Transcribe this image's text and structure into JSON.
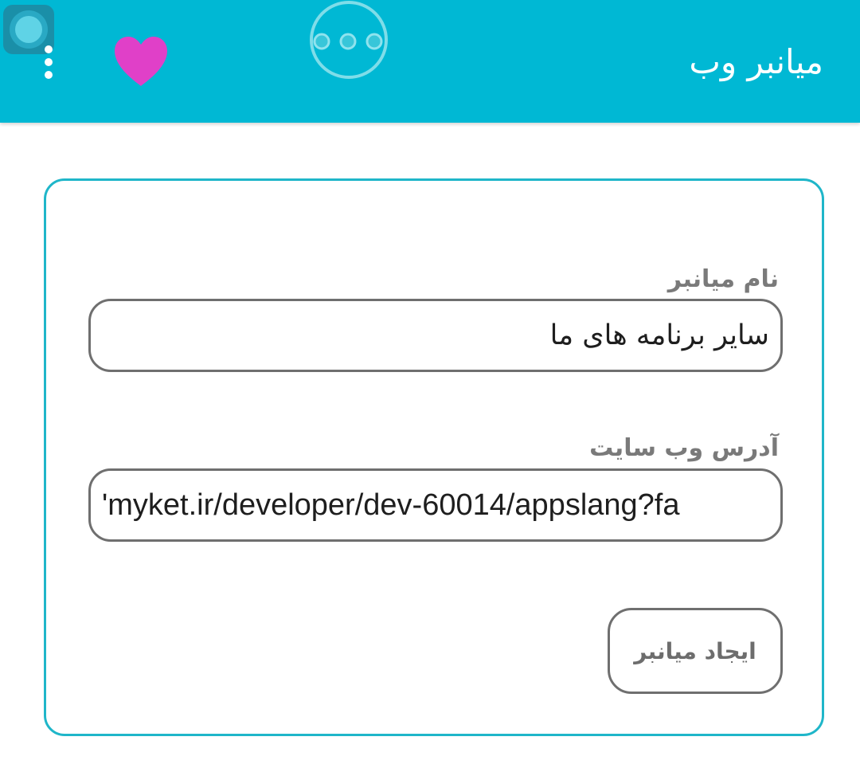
{
  "appbar": {
    "title": "میانبر وب",
    "color": "#00b8d4",
    "icons": {
      "menu": "overflow-menu-icon",
      "favorite": "heart-icon",
      "more": "more-horizontal-icon",
      "assistant": "assistant-bubble-icon"
    },
    "heart_color": "#e040c8"
  },
  "form": {
    "name_label": "نام میانبر",
    "name_value": "سایر برنامه های ما",
    "url_label": "آدرس وب سایت",
    "url_value": "'myket.ir/developer/dev-60014/appslang?fa",
    "create_label": "ایجاد میانبر",
    "border_color": "#1fb6c9"
  }
}
